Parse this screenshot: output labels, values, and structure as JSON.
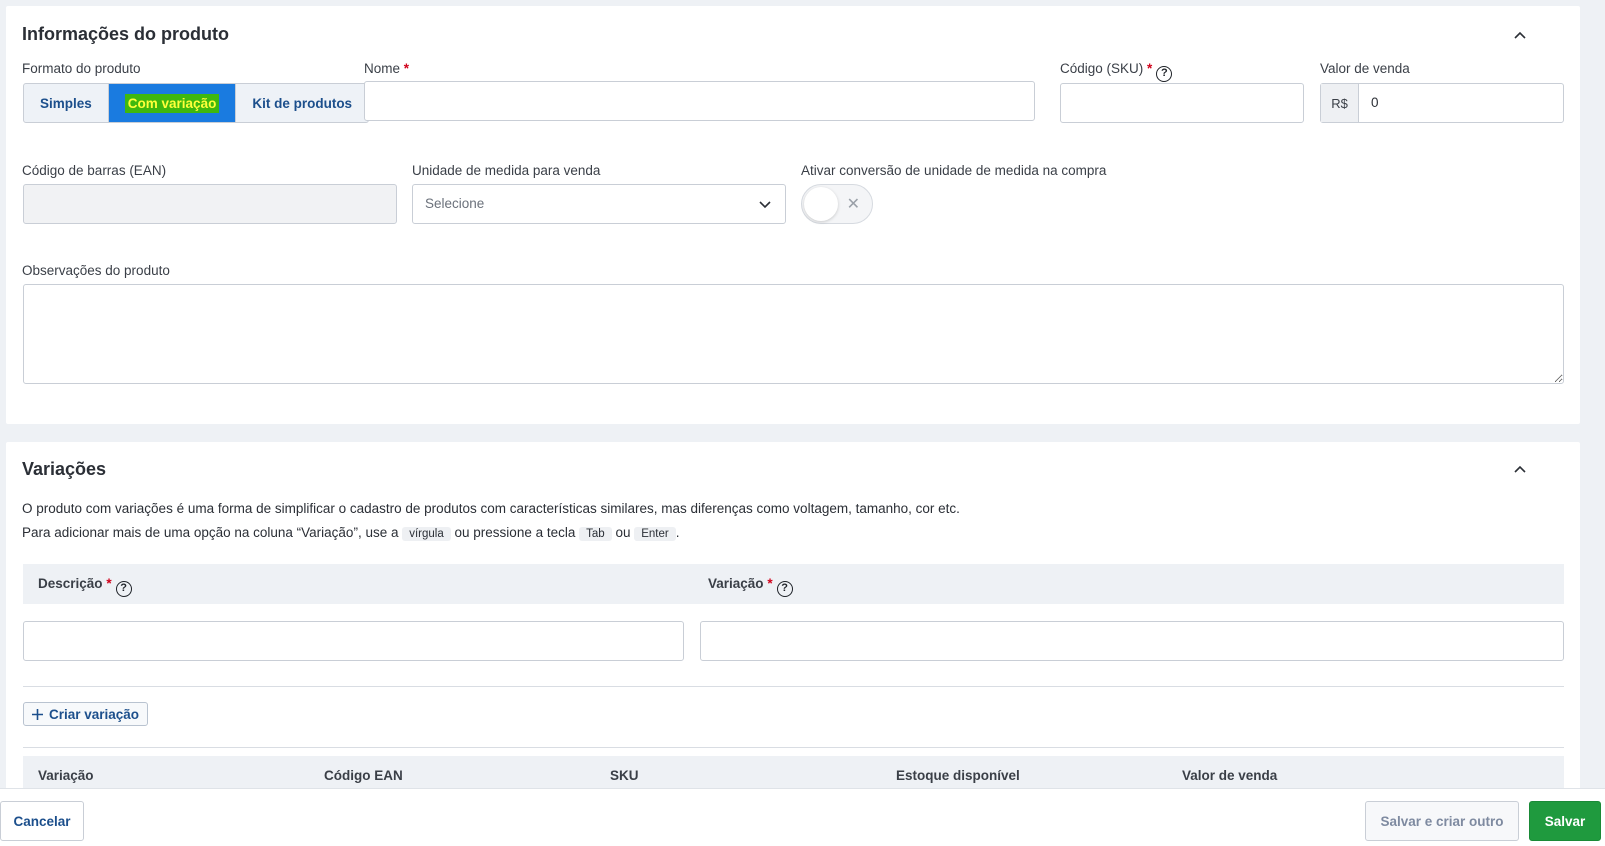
{
  "product_info": {
    "title": "Informações do produto",
    "format_label": "Formato do produto",
    "format_options": [
      "Simples",
      "Com variação",
      "Kit de produtos"
    ],
    "format_selected": "Com variação",
    "name_label": "Nome",
    "sku_label": "Código (SKU)",
    "sale_value_label": "Valor de venda",
    "currency_prefix": "R$",
    "sale_value": "0",
    "ean_label": "Código de barras (EAN)",
    "unit_label": "Unidade de medida para venda",
    "unit_placeholder": "Selecione",
    "conversion_label": "Ativar conversão de unidade de medida na compra",
    "conversion_enabled": false,
    "notes_label": "Observações do produto",
    "required_mark": "*"
  },
  "variations": {
    "title": "Variações",
    "intro_line1": "O produto com variações é uma forma de simplificar o cadastro de produtos com características similares, mas diferenças como voltagem, tamanho, cor etc.",
    "intro_line2_a": "Para adicionar mais de uma opção na coluna “Variação”, use a",
    "key_comma": "vírgula",
    "intro_line2_b": "ou pressione a tecla",
    "key_tab": "Tab",
    "intro_line2_c": "ou",
    "key_enter": "Enter",
    "intro_line2_d": ".",
    "col_description": "Descrição",
    "col_variation": "Variação",
    "add_button": "Criar variação",
    "table_headers": [
      "Variação",
      "Código EAN",
      "SKU",
      "Estoque disponível",
      "Valor de venda"
    ]
  },
  "footer": {
    "cancel": "Cancelar",
    "save_and_new": "Salvar e criar outro",
    "save": "Salvar"
  },
  "colors": {
    "primary_blue": "#1a7be0",
    "save_green": "#1f9a3e",
    "link_blue": "#1c4f8c"
  }
}
